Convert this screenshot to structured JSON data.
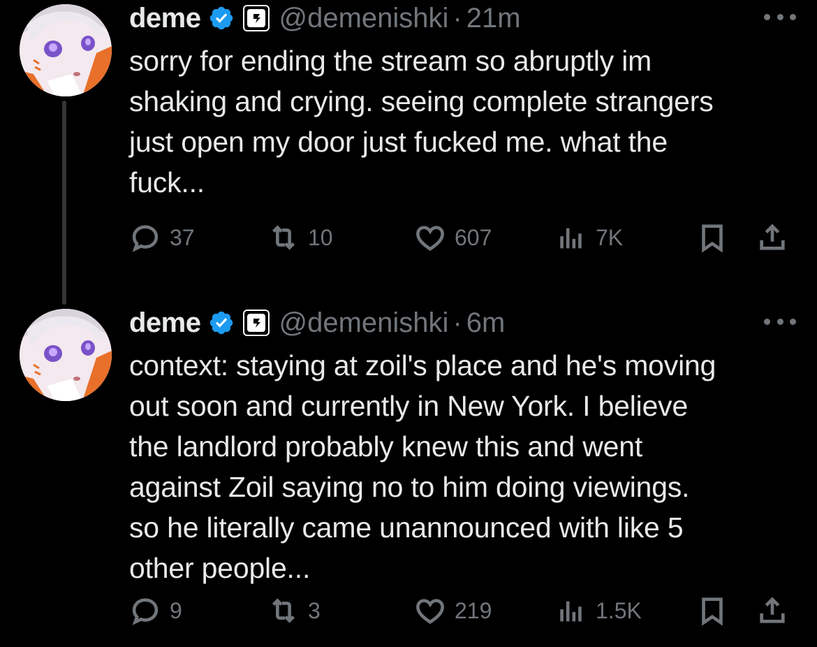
{
  "tweets": [
    {
      "name": "deme",
      "handle": "@demenishki",
      "separator": "·",
      "time": "21m",
      "text": "sorry for ending the stream so abruptly im\nshaking and crying. seeing complete strangers\njust open my door just fucked me. what the\nfuck...",
      "replies": "37",
      "retweets": "10",
      "likes": "607",
      "views": "7K"
    },
    {
      "name": "deme",
      "handle": "@demenishki",
      "separator": "·",
      "time": "6m",
      "text": "context: staying at zoil's place and he's moving\nout soon and currently in New York. I believe\nthe landlord probably knew this and went\nagainst Zoil saying no to him doing viewings.\nso he literally came unannounced with like 5\nother people...",
      "replies": "9",
      "retweets": "3",
      "likes": "219",
      "views": "1.5K"
    }
  ],
  "colors": {
    "background": "#000000",
    "text": "#e7e9ea",
    "muted": "#71767b",
    "verified": "#1d9bf0",
    "thread_line": "#333639"
  },
  "icons": [
    "verified-badge-icon",
    "affiliate-badge-icon",
    "more-icon",
    "reply-icon",
    "retweet-icon",
    "like-icon",
    "views-icon",
    "bookmark-icon",
    "share-icon"
  ]
}
